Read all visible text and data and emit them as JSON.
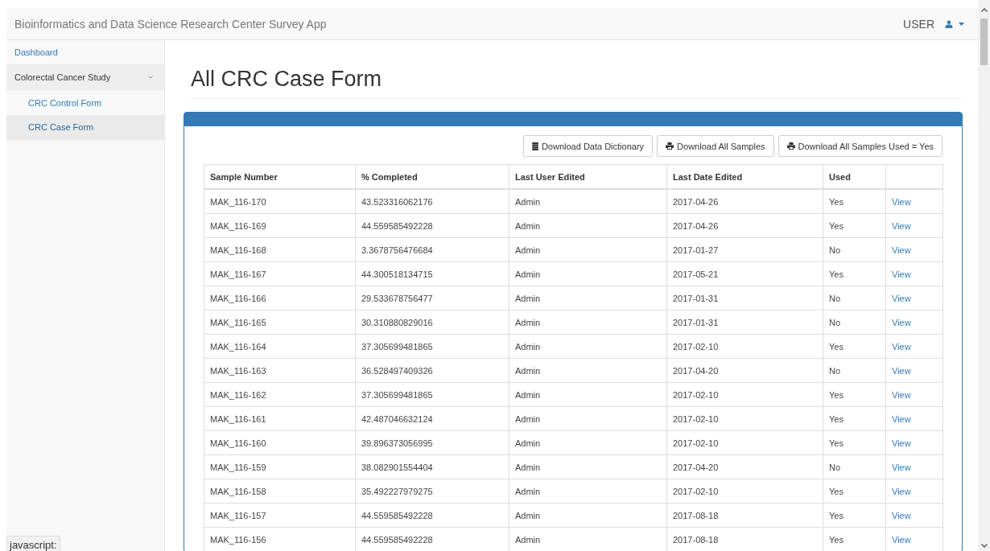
{
  "navbar": {
    "title": "Bioinformatics and Data Science Research Center Survey App",
    "user": "USER"
  },
  "sidebar": {
    "items": [
      {
        "label": "Dashboard",
        "selected": false
      },
      {
        "label": "Colorectal Cancer Study",
        "selected": false,
        "expanded": true,
        "children": [
          {
            "label": "CRC Control Form",
            "selected": false
          },
          {
            "label": "CRC Case Form",
            "selected": true
          }
        ]
      }
    ]
  },
  "page_title": "All CRC Case Form",
  "buttons": [
    {
      "label": "Download Data Dictionary",
      "kind": "database"
    },
    {
      "label": "Download All Samples",
      "kind": "print"
    },
    {
      "label": "Download All Samples Used = Yes",
      "kind": "print"
    }
  ],
  "table": {
    "columns": [
      "Sample Number",
      "% Completed",
      "Last User Edited",
      "Last Date Edited",
      "Used"
    ],
    "rows": [
      {
        "sample": "MAK_116-170",
        "completed": "43.523316062176",
        "user": "Admin",
        "date": "2017-04-26",
        "used": "Yes",
        "action": "View"
      },
      {
        "sample": "MAK_116-169",
        "completed": "44.559585492228",
        "user": "Admin",
        "date": "2017-04-26",
        "used": "Yes",
        "action": "View"
      },
      {
        "sample": "MAK_116-168",
        "completed": "3.3678756476684",
        "user": "Admin",
        "date": "2017-01-27",
        "used": "No",
        "action": "View"
      },
      {
        "sample": "MAK_116-167",
        "completed": "44.300518134715",
        "user": "Admin",
        "date": "2017-05-21",
        "used": "Yes",
        "action": "View"
      },
      {
        "sample": "MAK_116-166",
        "completed": "29.533678756477",
        "user": "Admin",
        "date": "2017-01-31",
        "used": "No",
        "action": "View"
      },
      {
        "sample": "MAK_116-165",
        "completed": "30.310880829016",
        "user": "Admin",
        "date": "2017-01-31",
        "used": "No",
        "action": "View"
      },
      {
        "sample": "MAK_116-164",
        "completed": "37.305699481865",
        "user": "Admin",
        "date": "2017-02-10",
        "used": "Yes",
        "action": "View"
      },
      {
        "sample": "MAK_116-163",
        "completed": "36.528497409326",
        "user": "Admin",
        "date": "2017-04-20",
        "used": "No",
        "action": "View"
      },
      {
        "sample": "MAK_116-162",
        "completed": "37.305699481865",
        "user": "Admin",
        "date": "2017-02-10",
        "used": "Yes",
        "action": "View"
      },
      {
        "sample": "MAK_116-161",
        "completed": "42.487046632124",
        "user": "Admin",
        "date": "2017-02-10",
        "used": "Yes",
        "action": "View"
      },
      {
        "sample": "MAK_116-160",
        "completed": "39.896373056995",
        "user": "Admin",
        "date": "2017-02-10",
        "used": "Yes",
        "action": "View"
      },
      {
        "sample": "MAK_116-159",
        "completed": "38.082901554404",
        "user": "Admin",
        "date": "2017-04-20",
        "used": "No",
        "action": "View"
      },
      {
        "sample": "MAK_116-158",
        "completed": "35.492227979275",
        "user": "Admin",
        "date": "2017-02-10",
        "used": "Yes",
        "action": "View"
      },
      {
        "sample": "MAK_116-157",
        "completed": "44.559585492228",
        "user": "Admin",
        "date": "2017-08-18",
        "used": "Yes",
        "action": "View"
      },
      {
        "sample": "MAK_116-156",
        "completed": "44.559585492228",
        "user": "Admin",
        "date": "2017-08-18",
        "used": "Yes",
        "action": "View"
      }
    ]
  },
  "status_bar": {
    "text": "javascript:"
  }
}
